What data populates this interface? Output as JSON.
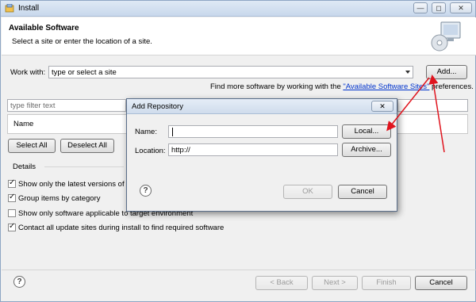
{
  "window": {
    "title": "Install",
    "controls": [
      "—",
      "◻",
      "✕"
    ]
  },
  "header": {
    "title": "Available Software",
    "subtitle": "Select a site or enter the location of a site."
  },
  "work_with": {
    "label": "Work with:",
    "value": "type or select a site",
    "add_label": "Add..."
  },
  "find_more": {
    "prefix": "Find more software by working with the ",
    "link": "\"Available Software Sites\"",
    "suffix": " preferences."
  },
  "filter": {
    "placeholder": "type filter text"
  },
  "table": {
    "column_name": "Name"
  },
  "select_all": "Select All",
  "deselect_all": "Deselect All",
  "details_label": "Details",
  "options": [
    {
      "label": "Show only the latest versions of av",
      "checked": true
    },
    {
      "label": "Group items by category",
      "checked": true
    },
    {
      "label": "Show only software applicable to target environment",
      "checked": false
    },
    {
      "label": "Contact all update sites during install to find required software",
      "checked": true
    }
  ],
  "footer": {
    "help": "?",
    "back": "< Back",
    "next": "Next >",
    "finish": "Finish",
    "cancel": "Cancel"
  },
  "dialog": {
    "title": "Add Repository",
    "close": "✕",
    "name_label": "Name:",
    "name_value": "",
    "local_label": "Local...",
    "location_label": "Location:",
    "location_value": "http://",
    "archive_label": "Archive...",
    "help": "?",
    "ok": "OK",
    "cancel": "Cancel"
  },
  "colors": {
    "link": "#0033cc",
    "annotation_arrow": "#e0141e",
    "title_bar": "#c8d8ec"
  }
}
